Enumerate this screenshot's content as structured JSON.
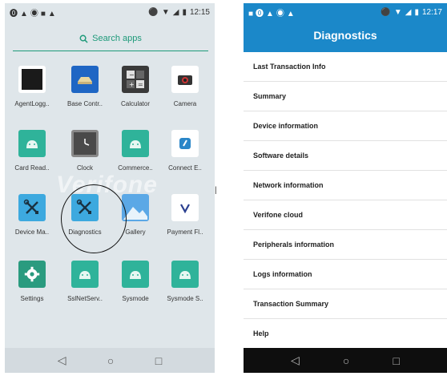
{
  "left_screen": {
    "status_bar": {
      "left_icons": "⓿▲◉■▲",
      "time": "12:15"
    },
    "search": {
      "label": "Search apps"
    },
    "apps": [
      {
        "label": "AgentLogg..",
        "icon": "agent-icon"
      },
      {
        "label": "Base Contr..",
        "icon": "base-control-icon"
      },
      {
        "label": "Calculator",
        "icon": "calculator-icon"
      },
      {
        "label": "Camera",
        "icon": "camera-icon"
      },
      {
        "label": "Card Read..",
        "icon": "android-icon"
      },
      {
        "label": "Clock",
        "icon": "clock-icon"
      },
      {
        "label": "Commerce..",
        "icon": "android-icon"
      },
      {
        "label": "Connect E..",
        "icon": "connect-icon"
      },
      {
        "label": "Device Ma..",
        "icon": "tools-icon"
      },
      {
        "label": "Diagnostics",
        "icon": "tools-icon"
      },
      {
        "label": "Gallery",
        "icon": "gallery-icon"
      },
      {
        "label": "Payment Fl..",
        "icon": "verifone-icon"
      },
      {
        "label": "Settings",
        "icon": "gear-icon"
      },
      {
        "label": "SslNetServ..",
        "icon": "android-icon"
      },
      {
        "label": "Sysmode",
        "icon": "android-icon"
      },
      {
        "label": "Sysmode S..",
        "icon": "android-icon"
      }
    ],
    "watermark": "Verifone",
    "nav": {
      "back": "◁",
      "home": "○",
      "recents": "□"
    }
  },
  "right_screen": {
    "status_bar": {
      "left_icons": "■⓿▲◉▲",
      "time": "12:17"
    },
    "title": "Diagnostics",
    "menu_items": [
      "Last Transaction Info",
      "Summary",
      "Device information",
      "Software details",
      "Network information",
      "Verifone cloud",
      "Peripherals information",
      "Logs information",
      "Transaction Summary",
      "Help"
    ],
    "nav": {
      "back": "◁",
      "home": "○",
      "recents": "□"
    }
  },
  "colors": {
    "accent_teal": "#1e9a7a",
    "header_blue": "#1b88c9",
    "android_green": "#2fb39a"
  }
}
